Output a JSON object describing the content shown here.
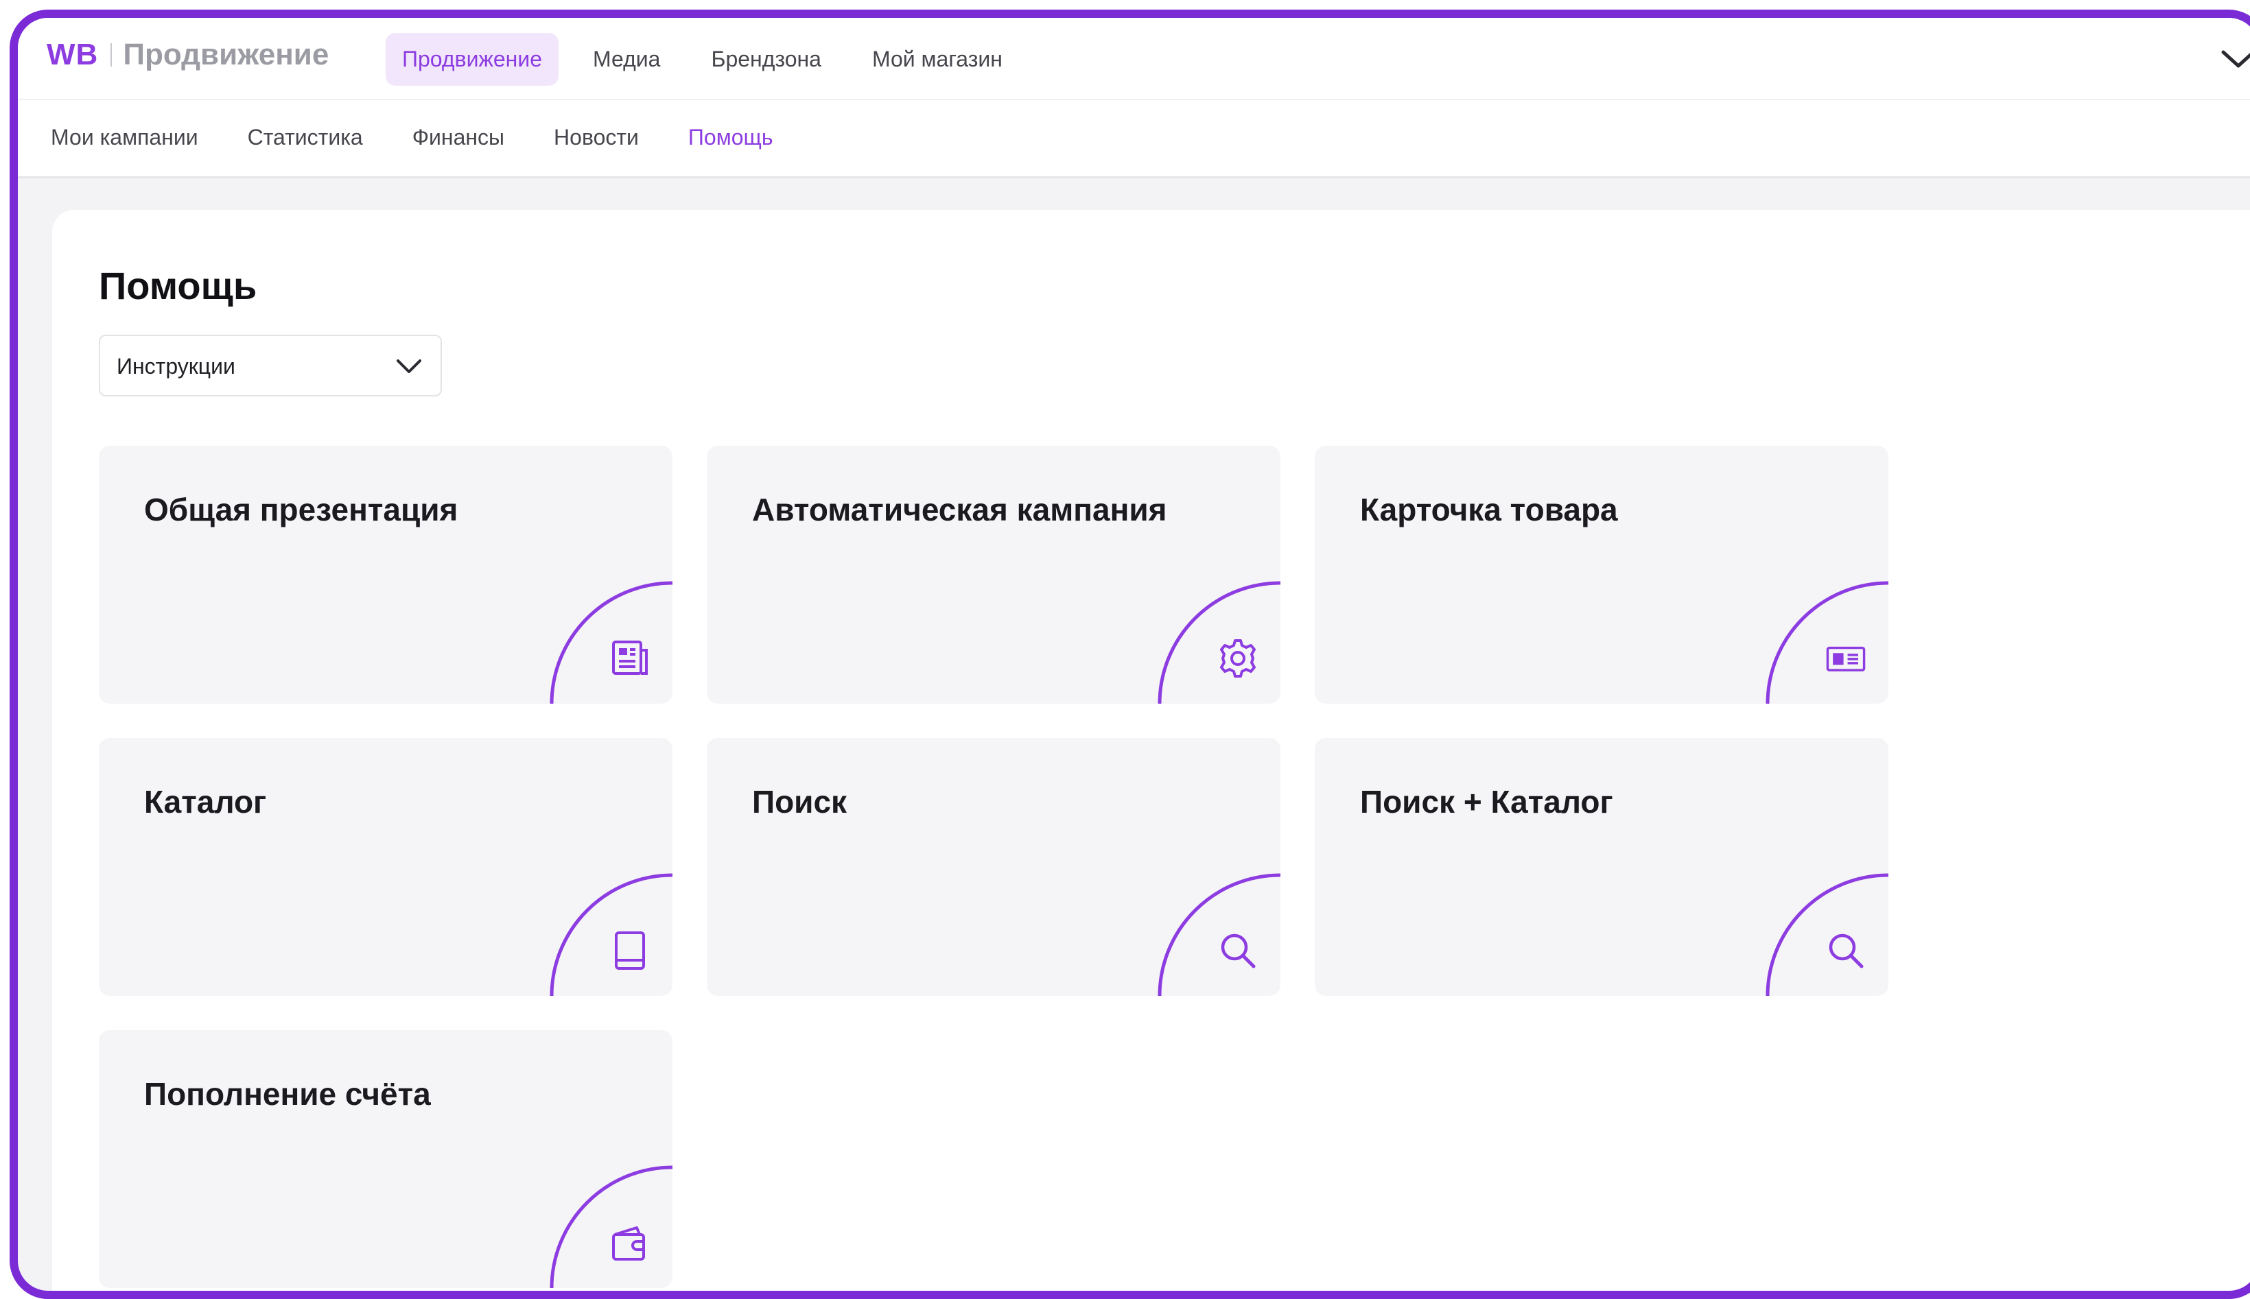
{
  "header": {
    "logo_brand": "WB",
    "logo_product": "Продвижение",
    "nav": [
      {
        "label": "Продвижение",
        "active": true
      },
      {
        "label": "Медиа",
        "active": false
      },
      {
        "label": "Брендзона",
        "active": false
      },
      {
        "label": "Мой магазин",
        "active": false
      }
    ]
  },
  "subnav": [
    {
      "label": "Мои кампании",
      "active": false
    },
    {
      "label": "Статистика",
      "active": false
    },
    {
      "label": "Финансы",
      "active": false
    },
    {
      "label": "Новости",
      "active": false
    },
    {
      "label": "Помощь",
      "active": true
    }
  ],
  "page": {
    "title": "Помощь",
    "filter": {
      "value": "Инструкции"
    }
  },
  "cards": [
    {
      "title": "Общая презентация",
      "icon": "presentation-icon"
    },
    {
      "title": "Автоматическая кампания",
      "icon": "gear-icon"
    },
    {
      "title": "Карточка товара",
      "icon": "product-card-icon"
    },
    {
      "title": "Каталог",
      "icon": "catalog-book-icon"
    },
    {
      "title": "Поиск",
      "icon": "search-icon"
    },
    {
      "title": "Поиск + Каталог",
      "icon": "search-icon"
    },
    {
      "title": "Пополнение счёта",
      "icon": "wallet-icon"
    }
  ],
  "colors": {
    "accent": "#8c3ce0",
    "frame": "#7b2bd6",
    "card_background": "#f5f5f7",
    "page_background": "#f3f3f5"
  }
}
